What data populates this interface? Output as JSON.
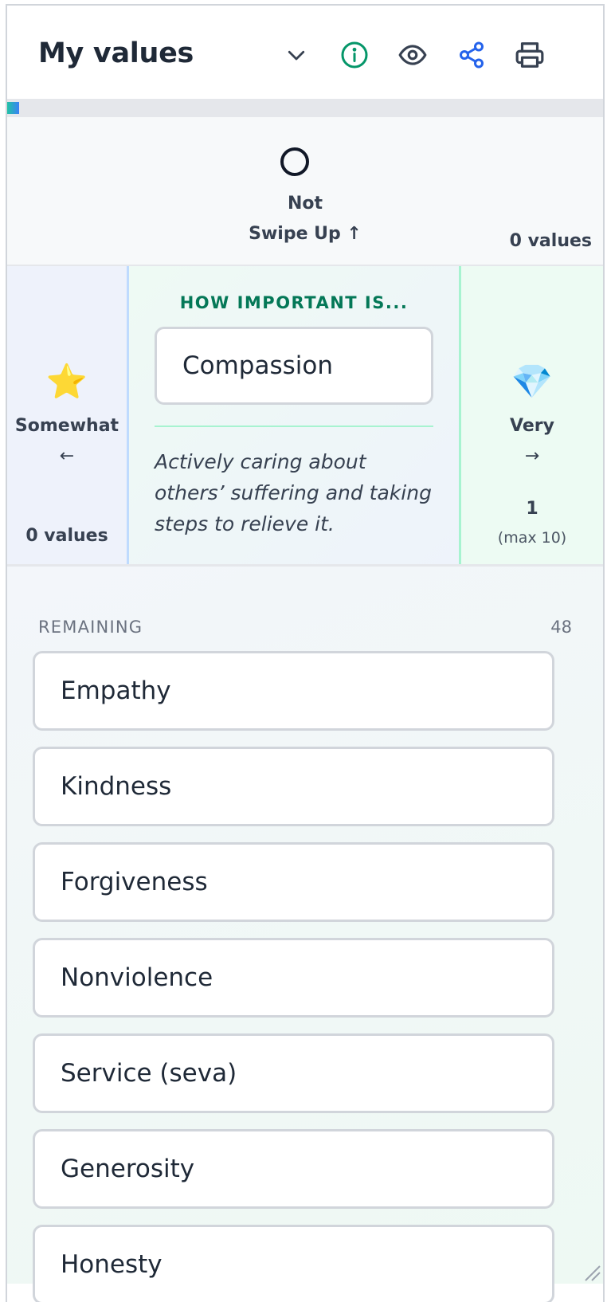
{
  "header": {
    "title": "My values",
    "icons": [
      "chevron-down-icon",
      "info-icon",
      "eye-icon",
      "share-icon",
      "printer-icon"
    ],
    "colors": {
      "info": "#059669",
      "share": "#2563eb",
      "default": "#374151"
    }
  },
  "progress": {
    "fraction": 0.02,
    "colors": [
      "#22c3a6",
      "#3b82f6"
    ]
  },
  "not_zone": {
    "label": "Not",
    "hint": "Swipe Up ↑",
    "count": "0 values"
  },
  "somewhat_zone": {
    "icon": "⭐",
    "label": "Somewhat",
    "arrow": "←",
    "count": "0 values"
  },
  "very_zone": {
    "icon": "💎",
    "label": "Very",
    "arrow": "→",
    "count": "1",
    "max": "(max 10)"
  },
  "question": {
    "heading": "HOW IMPORTANT IS...",
    "current": "Compassion",
    "description": "Actively caring about others’ suffering and taking steps to relieve it."
  },
  "remaining": {
    "label": "REMAINING",
    "count": "48",
    "items": [
      "Empathy",
      "Kindness",
      "Forgiveness",
      "Nonviolence",
      "Service (seva)",
      "Generosity",
      "Honesty"
    ]
  }
}
